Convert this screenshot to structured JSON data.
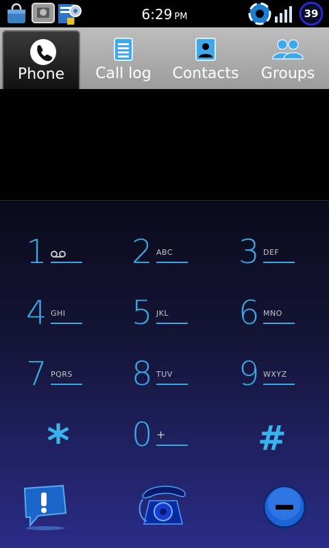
{
  "status_bar": {
    "time": "6:29",
    "ampm": "PM",
    "battery_level": "39"
  },
  "tabs": [
    {
      "label": "Phone",
      "icon": "phone-icon",
      "active": true
    },
    {
      "label": "Call log",
      "icon": "call-log-icon",
      "active": false
    },
    {
      "label": "Contacts",
      "icon": "contacts-icon",
      "active": false
    },
    {
      "label": "Groups",
      "icon": "groups-icon",
      "active": false
    }
  ],
  "dial_display": {
    "number": ""
  },
  "keypad": {
    "keys": [
      {
        "digit": "1",
        "letters": ""
      },
      {
        "digit": "2",
        "letters": "ABC"
      },
      {
        "digit": "3",
        "letters": "DEF"
      },
      {
        "digit": "4",
        "letters": "GHI"
      },
      {
        "digit": "5",
        "letters": "JKL"
      },
      {
        "digit": "6",
        "letters": "MNO"
      },
      {
        "digit": "7",
        "letters": "PQRS"
      },
      {
        "digit": "8",
        "letters": "TUV"
      },
      {
        "digit": "9",
        "letters": "WXYZ"
      },
      {
        "digit": "*",
        "letters": ""
      },
      {
        "digit": "0",
        "letters": "+"
      },
      {
        "digit": "#",
        "letters": ""
      }
    ]
  },
  "bottom_actions": [
    {
      "icon": "voicemail-alert-icon"
    },
    {
      "icon": "dial-phone-icon"
    },
    {
      "icon": "delete-icon"
    }
  ],
  "colors": {
    "accent": "#3aa9e4",
    "pad_bottom": "#2a2c88"
  }
}
